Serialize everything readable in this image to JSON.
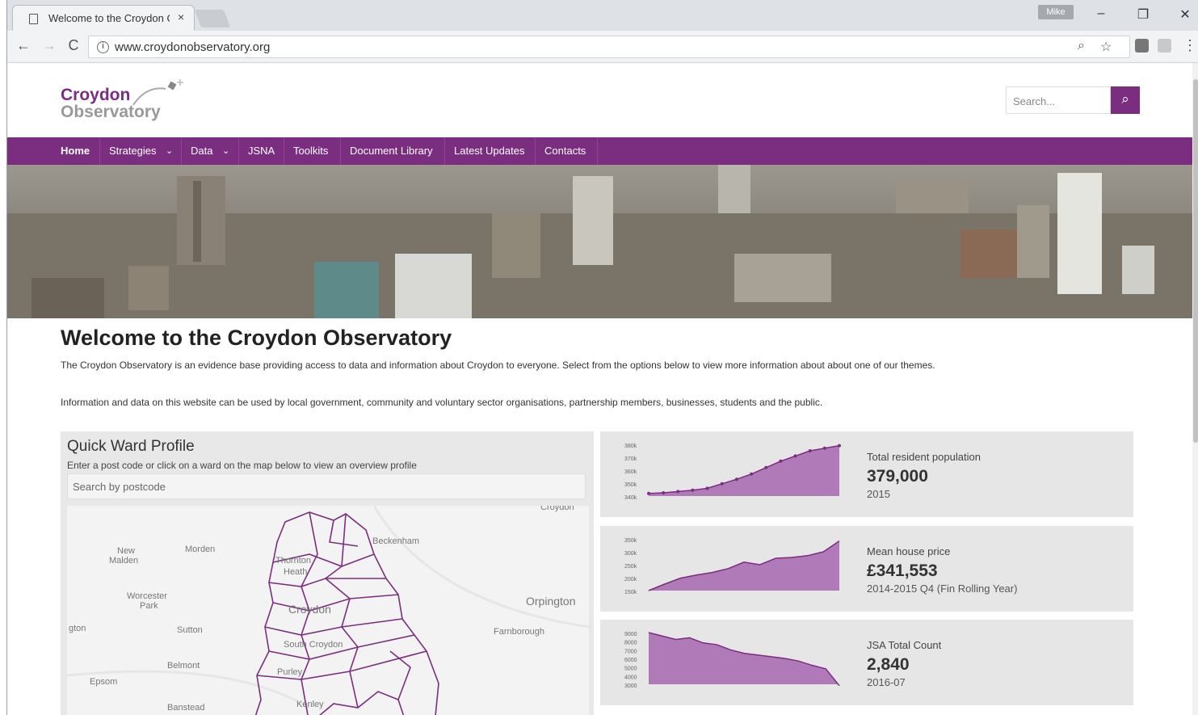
{
  "browser": {
    "tab_title": "Welcome to the Croydon Observatory",
    "tab_close": "×",
    "user_badge": "Mike",
    "url": "www.croydonobservatory.org",
    "win_min": "–",
    "win_max": "❐",
    "win_close": "✕",
    "back": "←",
    "forward": "→",
    "reload": "C",
    "info": "i",
    "zoom_icon": "⌕",
    "star_icon": "☆",
    "menu_icon": "⋮"
  },
  "header": {
    "logo_line1": "Croydon",
    "logo_line2": "Observatory",
    "search_placeholder": "Search...",
    "search_button": "⌕"
  },
  "nav": {
    "items": [
      "Home",
      "Strategies",
      "Data",
      "JSNA",
      "Toolkits",
      "Document Library",
      "Latest Updates",
      "Contacts"
    ],
    "dropdown_caret": "⌄"
  },
  "main": {
    "title": "Welcome to the Croydon Observatory",
    "intro1": "The Croydon Observatory is an evidence base providing access to data and information about Croydon to everyone. Select from the options below to view more information about about one of our themes.",
    "intro2": "Information and data on this website can be used by local government, community and voluntary sector organisations, partnership members, businesses, students and the public."
  },
  "ward_profile": {
    "title": "Quick Ward Profile",
    "subtitle": "Enter a post code or click on a ward on the map below to view an overview profile",
    "search_placeholder": "Search by postcode",
    "map_labels": [
      "Croydon",
      "New",
      "Malden",
      "Morden",
      "Thornton",
      "Heath",
      "Beckenham",
      "Worcester",
      "Park",
      "Croydon",
      "Orpington",
      "gton",
      "Sutton",
      "Farnborough",
      "South Croydon",
      "Belmont",
      "Purley",
      "Epsom",
      "Banstead",
      "Kenley"
    ]
  },
  "stats": [
    {
      "label": "Total resident population",
      "value": "379,000",
      "date": "2015",
      "ticks": [
        "380k",
        "370k",
        "360k",
        "350k",
        "340k"
      ],
      "chart_data": {
        "type": "area",
        "values": [
          342,
          342.5,
          343.5,
          344.5,
          346,
          349.5,
          353,
          357,
          362,
          367,
          371,
          375,
          377,
          379
        ],
        "ylim": [
          340,
          380
        ]
      }
    },
    {
      "label": "Mean house price",
      "value": "£341,553",
      "date": "2014-2015 Q4 (Fin Rolling Year)",
      "ticks": [
        "350k",
        "300k",
        "250k",
        "200k",
        "150k"
      ],
      "chart_data": {
        "type": "area",
        "values": [
          150,
          175,
          198,
          210,
          220,
          235,
          260,
          250,
          275,
          278,
          285,
          300,
          342
        ],
        "ylim": [
          150,
          350
        ]
      }
    },
    {
      "label": "JSA Total Count",
      "value": "2,840",
      "date": "2016-07",
      "ticks": [
        "9000",
        "8000",
        "7000",
        "6000",
        "5000",
        "4000",
        "3000"
      ],
      "chart_data": {
        "type": "area",
        "values": [
          9000,
          8600,
          8200,
          8400,
          7800,
          7600,
          7000,
          6600,
          6400,
          6200,
          6000,
          5700,
          5200,
          4800,
          2840
        ],
        "ylim": [
          3000,
          9000
        ]
      }
    }
  ],
  "colors": {
    "brand": "#7b2d7f",
    "chart_fill": "#b07ab8",
    "chart_line": "#7b2d7f"
  }
}
